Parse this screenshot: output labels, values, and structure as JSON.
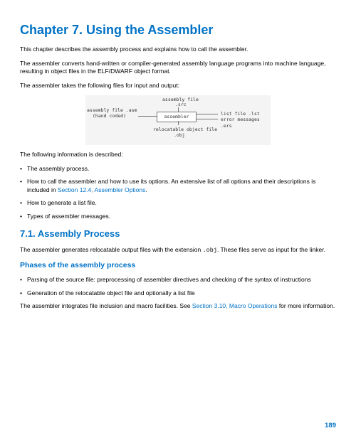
{
  "chapter_title": "Chapter 7. Using the Assembler",
  "para1": "This chapter describes the assembly process and explains how to call the assembler.",
  "para2": "The assembler converts hand-written or compiler-generated assembly language programs into machine language, resulting in object files in the ELF/DWARF object format.",
  "para3": "The assembler takes the following files for input and output:",
  "diagram": {
    "top_label1": "assembly file",
    "top_label2": ".src",
    "left_label1": "assembly file .asm",
    "left_label2": "(hand coded)",
    "box": "assembler",
    "right_label1": "list file .lst",
    "right_label2": "error messages .ers",
    "bottom_label1": "relocatable object file",
    "bottom_label2": ".obj"
  },
  "para4": "The following information is described:",
  "list1": {
    "item1": "The assembly process.",
    "item2_a": "How to call the assembler and how to use its options. An extensive list of all options and their descriptions is included in ",
    "item2_link": "Section 12.4, Assembler Options",
    "item2_b": ".",
    "item3": "How to generate a list file.",
    "item4": "Types of assembler messages."
  },
  "section_title": "7.1. Assembly Process",
  "para5_a": "The assembler generates relocatable output files with the extension ",
  "para5_code": ".obj",
  "para5_b": ". These files serve as input for the linker.",
  "subsection_title": "Phases of the assembly process",
  "list2": {
    "item1": "Parsing of the source file: preprocessing of assembler directives and checking of the syntax of instructions",
    "item2": "Generation of the relocatable object file and optionally a list file"
  },
  "para6_a": "The assembler integrates file inclusion and macro facilities. See ",
  "para6_link": "Section 3.10, Macro Operations",
  "para6_b": " for more information.",
  "page_number": "189"
}
